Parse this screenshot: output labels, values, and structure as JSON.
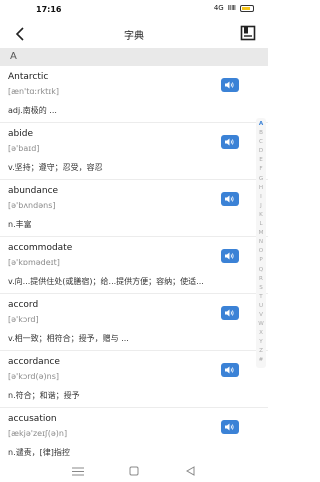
{
  "status": {
    "time": "17:16",
    "signal": "ⅡⅢ",
    "sim": "4G"
  },
  "header": {
    "title": "字典",
    "back_icon": "back-arrow-icon",
    "book_icon": "book-icon"
  },
  "section": "A",
  "entries": [
    {
      "word": "Antarctic",
      "phonetic": "[æn'tɑːrktɪk]",
      "definition": "adj.南极的  ..."
    },
    {
      "word": "abide",
      "phonetic": "[ə'baɪd]",
      "definition": "v.坚持；遵守；忍受，容忍"
    },
    {
      "word": "abundance",
      "phonetic": "[ə'bʌndəns]",
      "definition": "n.丰富"
    },
    {
      "word": "accommodate",
      "phonetic": "[ə'kɒmədeɪt]",
      "definition": "v.向...提供住处(或膳宿)；给...提供方便；容纳；使适..."
    },
    {
      "word": "accord",
      "phonetic": "[ə'kɔrd]",
      "definition": "v.相一致；相符合；授予，赠与 ..."
    },
    {
      "word": "accordance",
      "phonetic": "[ə'kɔrd(ə)ns]",
      "definition": "n.符合；和谐；授予"
    },
    {
      "word": "accusation",
      "phonetic": "[ækjə'zeɪʃ(ə)n]",
      "definition": "n.谴责，[律]指控"
    }
  ],
  "alphabet": [
    "A",
    "B",
    "C",
    "D",
    "E",
    "F",
    "G",
    "H",
    "I",
    "J",
    "K",
    "L",
    "M",
    "N",
    "O",
    "P",
    "Q",
    "R",
    "S",
    "T",
    "U",
    "V",
    "W",
    "X",
    "Y",
    "Z",
    "#"
  ],
  "active_letter": "A",
  "colors": {
    "accent": "#3b82d6",
    "section_bg": "#e9e9e9"
  }
}
